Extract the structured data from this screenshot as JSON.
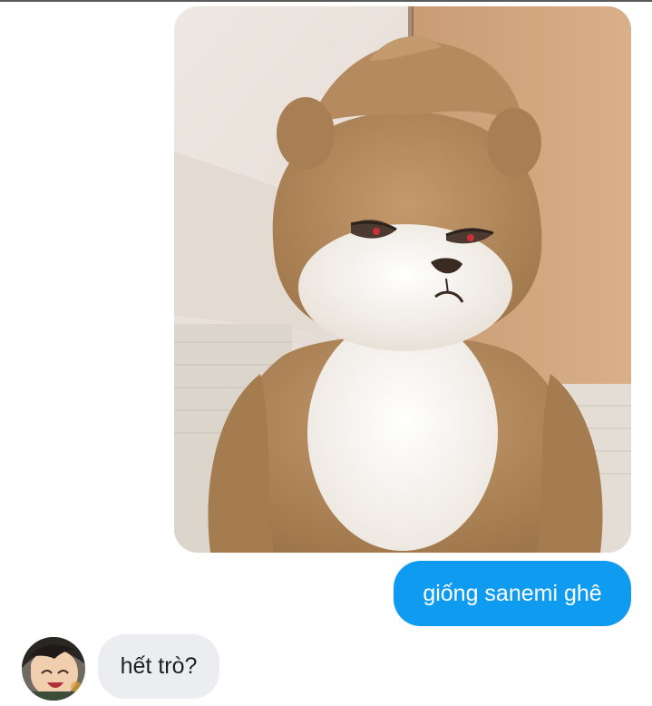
{
  "conversation": {
    "messages": [
      {
        "direction": "outgoing",
        "type": "image",
        "image_subject": "plush-toy-photo"
      },
      {
        "direction": "outgoing",
        "type": "text",
        "text": "giống sanemi ghê"
      },
      {
        "direction": "incoming",
        "type": "text",
        "text": "hết trò?",
        "avatar": "user-avatar"
      }
    ]
  },
  "colors": {
    "outgoing_bubble": "#0f9bf0",
    "incoming_bubble": "#ebedf0",
    "outgoing_text": "#ffffff",
    "incoming_text": "#1c1e21",
    "background": "#ffffff"
  }
}
